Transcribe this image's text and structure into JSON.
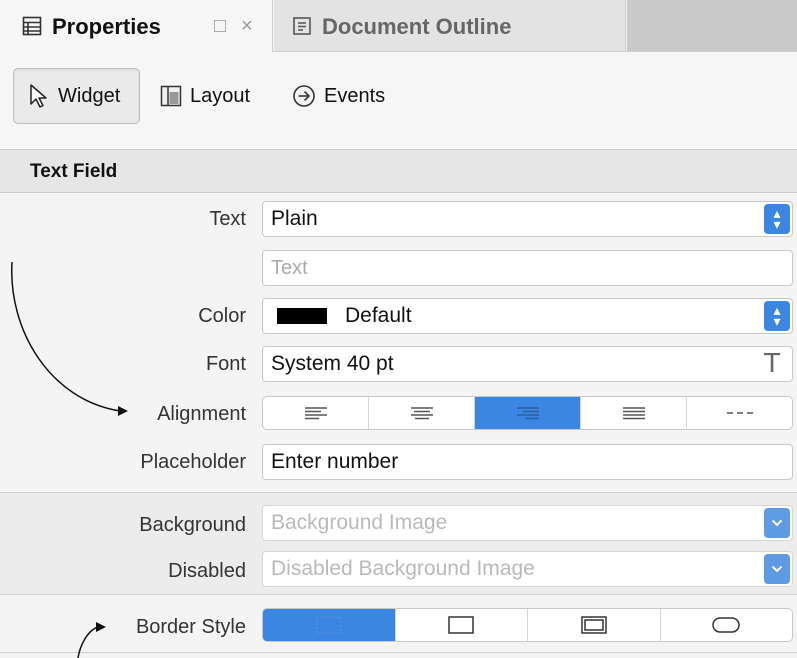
{
  "tabs": [
    {
      "label": "Properties",
      "active": true,
      "icon": "properties-panel-icon"
    },
    {
      "label": "Document Outline",
      "active": false,
      "icon": "document-outline-icon"
    }
  ],
  "tab_controls": {
    "maximize": "□",
    "close": "×"
  },
  "inspector_tabs": [
    {
      "label": "Widget",
      "icon": "cursor-arrow-icon",
      "selected": true
    },
    {
      "label": "Layout",
      "icon": "layout-grid-icon",
      "selected": false
    },
    {
      "label": "Events",
      "icon": "arrow-circle-right-icon",
      "selected": false
    }
  ],
  "section": {
    "title": "Text Field"
  },
  "properties": {
    "text": {
      "label": "Text",
      "value": "Plain",
      "text_placeholder": "Text"
    },
    "color": {
      "label": "Color",
      "value": "Default",
      "swatch": "#000000"
    },
    "font": {
      "label": "Font",
      "value": "System 40 pt",
      "glyph": "T"
    },
    "alignment": {
      "label": "Alignment",
      "options": [
        "left",
        "center",
        "right",
        "justified",
        "natural"
      ],
      "selected": "right"
    },
    "placeholder": {
      "label": "Placeholder",
      "value": "Enter number"
    },
    "background": {
      "label": "Background",
      "placeholder": "Background Image"
    },
    "disabled": {
      "label": "Disabled",
      "placeholder": "Disabled Background Image"
    },
    "border_style": {
      "label": "Border Style",
      "options": [
        "none",
        "line",
        "bezel",
        "rounded"
      ],
      "selected": "none"
    }
  },
  "colors": {
    "accent": "#3a86e0",
    "tab_active_bg": "#f6f6f6",
    "panel_bg": "#f4f4f4"
  }
}
